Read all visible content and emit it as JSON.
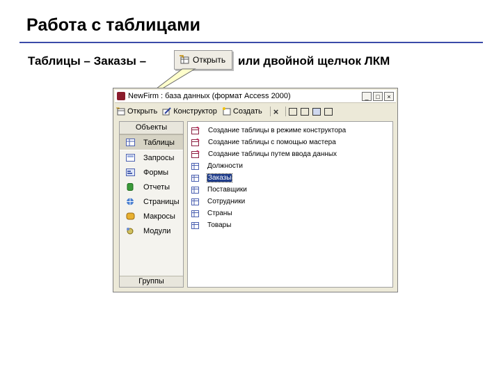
{
  "slide": {
    "title": "Работа с таблицами",
    "subtitle_prefix": "Таблицы – Заказы –",
    "subtitle_suffix": "или двойной щелчок ЛКМ",
    "callout_button": {
      "label": "Открыть",
      "icon": "open-table-icon"
    }
  },
  "window": {
    "title": "NewFirm : база данных (формат Access 2000)",
    "controls": {
      "minimize": "_",
      "maximize": "□",
      "close": "×"
    },
    "toolbar": {
      "open_label": "Открыть",
      "design_label": "Конструктор",
      "create_label": "Создать",
      "delete_icon": "×"
    },
    "objects_panel": {
      "header": "Объекты",
      "items": [
        {
          "label": "Таблицы",
          "icon": "tables-icon"
        },
        {
          "label": "Запросы",
          "icon": "queries-icon"
        },
        {
          "label": "Формы",
          "icon": "forms-icon"
        },
        {
          "label": "Отчеты",
          "icon": "reports-icon"
        },
        {
          "label": "Страницы",
          "icon": "pages-icon"
        },
        {
          "label": "Макросы",
          "icon": "macros-icon"
        },
        {
          "label": "Модули",
          "icon": "modules-icon"
        }
      ],
      "active_index": 0,
      "footer": "Группы"
    },
    "object_list": {
      "wizards": [
        "Создание таблицы в режиме конструктора",
        "Создание таблицы с помощью мастера",
        "Создание таблицы путем ввода данных"
      ],
      "tables": [
        "Должности",
        "Заказы",
        "Поставщики",
        "Сотрудники",
        "Страны",
        "Товары"
      ],
      "selected": "Заказы"
    }
  },
  "colors": {
    "accent": "#3a4aa8",
    "selection": "#1f3d8c",
    "window_bg": "#ece9d8"
  }
}
